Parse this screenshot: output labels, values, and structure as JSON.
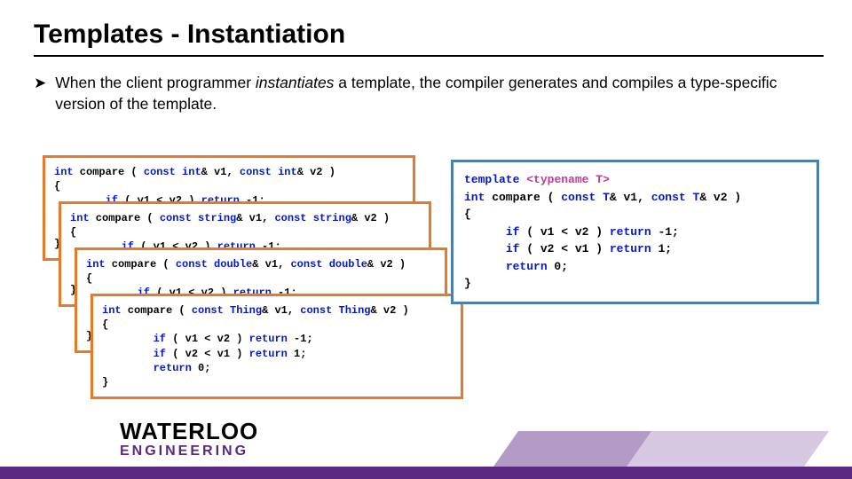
{
  "title": "Templates - Instantiation",
  "bullet": {
    "mark": "➤",
    "pre": "When the client programmer ",
    "em": "instantiates",
    "post": " a template, the compiler generates and compiles a type-specific version of the template."
  },
  "code": {
    "int_box": "int compare ( const int& v1, const int& v2 )\n{\n        if ( v1 < v2 ) return -1;\n        if ( v2 < v1 ) return 1;\n        return 0;\n}",
    "string_box": "int compare ( const string& v1, const string& v2 )\n{\n        if ( v1 < v2 ) return -1;\n        if ( v2 < v1 ) return 1;\n        return 0;\n}",
    "double_box": "int compare ( const double& v1, const double& v2 )\n{\n        if ( v1 < v2 ) return -1;\n        if ( v2 < v1 ) return 1;\n        return 0;\n}",
    "thing_box": "int compare ( const Thing& v1, const Thing& v2 )\n{\n        if ( v1 < v2 ) return -1;\n        if ( v2 < v1 ) return 1;\n        return 0;\n}",
    "template_box": "template <typename T>\nint compare ( const T& v1, const T& v2 )\n{\n      if ( v1 < v2 ) return -1;\n      if ( v2 < v1 ) return 1;\n      return 0;\n}"
  },
  "logo": {
    "line1": "WATERLOO",
    "line2": "ENGINEERING"
  }
}
